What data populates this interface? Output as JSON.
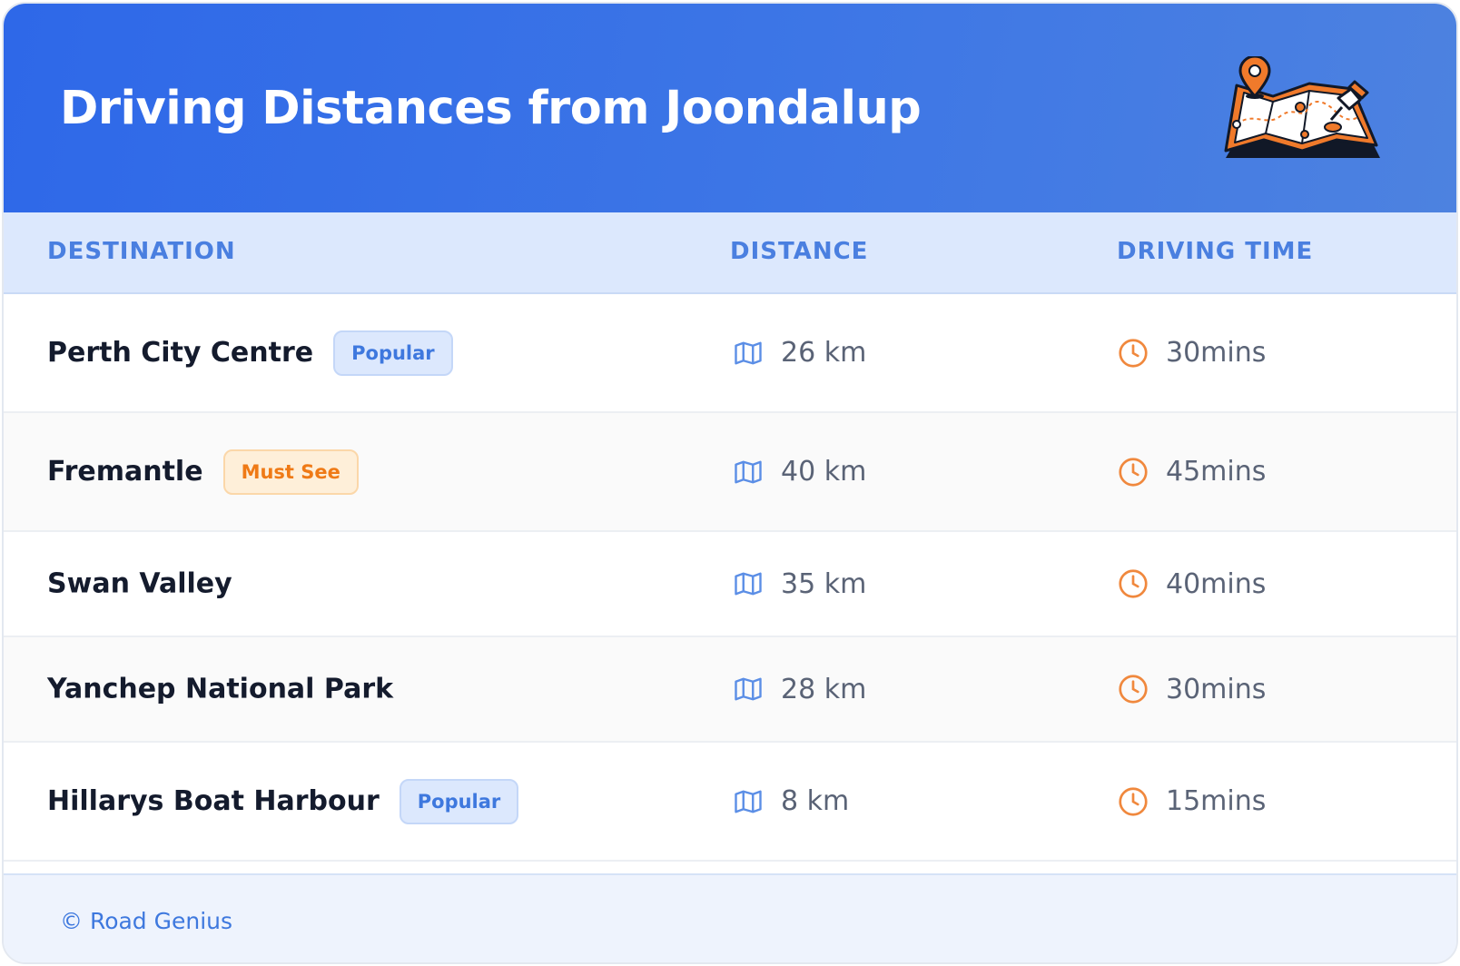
{
  "header": {
    "title": "Driving Distances from Joondalup"
  },
  "table": {
    "columns": {
      "destination": "DESTINATION",
      "distance": "DISTANCE",
      "driving_time": "DRIVING TIME"
    },
    "rows": [
      {
        "destination": "Perth City Centre",
        "badge": "Popular",
        "badge_type": "popular",
        "distance": "26 km",
        "time": "30mins"
      },
      {
        "destination": "Fremantle",
        "badge": "Must See",
        "badge_type": "must-see",
        "distance": "40 km",
        "time": "45mins"
      },
      {
        "destination": "Swan Valley",
        "badge": "",
        "badge_type": "",
        "distance": "35 km",
        "time": "40mins"
      },
      {
        "destination": "Yanchep National Park",
        "badge": "",
        "badge_type": "",
        "distance": "28 km",
        "time": "30mins"
      },
      {
        "destination": "Hillarys Boat Harbour",
        "badge": "Popular",
        "badge_type": "popular",
        "distance": "8 km",
        "time": "15mins"
      }
    ]
  },
  "footer": {
    "copyright": "© Road Genius"
  },
  "icons": {
    "distance": "map-icon",
    "time": "clock-icon",
    "header": "treasure-map-illustration"
  },
  "colors": {
    "header_gradient_start": "#2e68e8",
    "header_gradient_end": "#4d82e0",
    "accent_blue": "#4a7fe0",
    "accent_orange": "#ef7a16"
  }
}
